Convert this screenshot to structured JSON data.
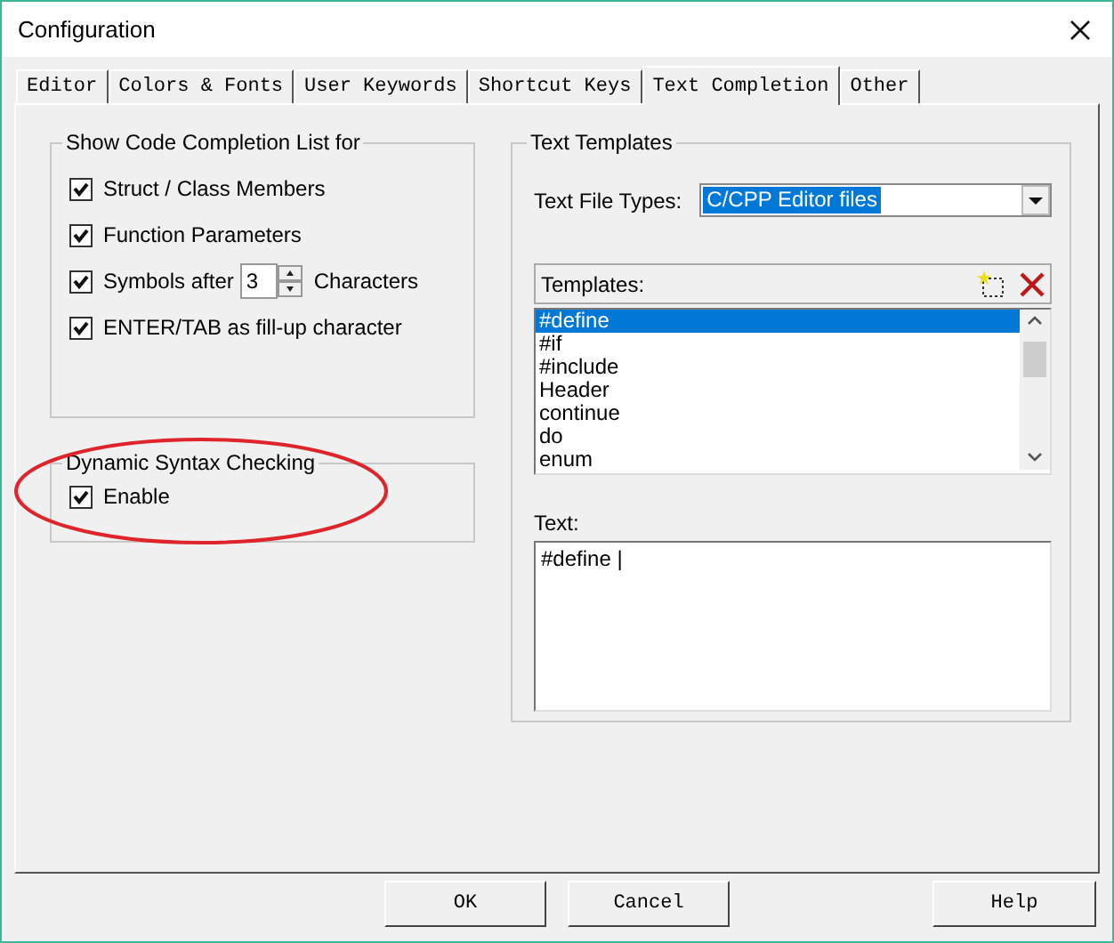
{
  "window": {
    "title": "Configuration"
  },
  "tabs": [
    {
      "label": "Editor",
      "selected": false
    },
    {
      "label": "Colors & Fonts",
      "selected": false
    },
    {
      "label": "User Keywords",
      "selected": false
    },
    {
      "label": "Shortcut Keys",
      "selected": false
    },
    {
      "label": "Text Completion",
      "selected": true
    },
    {
      "label": "Other",
      "selected": false
    }
  ],
  "completion_group": {
    "title": "Show Code Completion List for",
    "options": [
      {
        "kind": "checkbox",
        "label": "Struct / Class Members",
        "checked": true
      },
      {
        "kind": "checkbox",
        "label": "Function Parameters",
        "checked": true
      },
      {
        "kind": "spin",
        "label": "Symbols after",
        "value": "3",
        "unit": "Characters",
        "checked": true
      },
      {
        "kind": "checkbox",
        "label": "ENTER/TAB as fill-up character",
        "checked": true
      }
    ]
  },
  "syntax_group": {
    "title": "Dynamic Syntax Checking",
    "options": [
      {
        "label": "Enable",
        "checked": true
      }
    ]
  },
  "templates": {
    "title": "Text Templates",
    "file_types_label": "Text File Types:",
    "file_types_value": "C/CPP Editor files",
    "file_types_highlighted": true,
    "list_label": "Templates:",
    "items": [
      {
        "label": "#define",
        "selected": true
      },
      {
        "label": "#if",
        "selected": false
      },
      {
        "label": "#include",
        "selected": false
      },
      {
        "label": "Header",
        "selected": false
      },
      {
        "label": "continue",
        "selected": false
      },
      {
        "label": "do",
        "selected": false
      },
      {
        "label": "enum",
        "selected": false
      }
    ],
    "text_label": "Text:",
    "text_value": "#define |"
  },
  "buttons": [
    "OK",
    "Cancel",
    "Help"
  ],
  "annotations": [
    {
      "kind": "ellipse",
      "color": "#e0242b"
    }
  ]
}
